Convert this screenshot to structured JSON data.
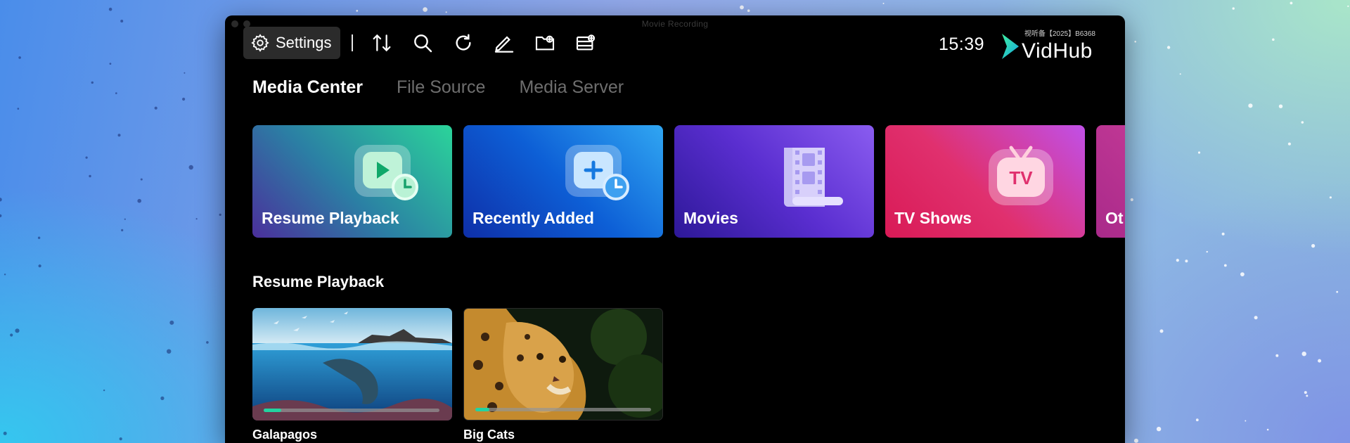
{
  "window": {
    "title": "Movie Recording"
  },
  "toolbar": {
    "settings_label": "Settings",
    "icons": [
      "sort-icon",
      "search-icon",
      "refresh-icon",
      "edit-icon",
      "add-folder-icon",
      "add-server-icon"
    ]
  },
  "header": {
    "time": "15:39",
    "logo_text": "VidHub",
    "logo_caption": "视听备【2025】B6368"
  },
  "tabs": [
    {
      "label": "Media Center",
      "active": true
    },
    {
      "label": "File Source",
      "active": false
    },
    {
      "label": "Media Server",
      "active": false
    }
  ],
  "categories": [
    {
      "label": "Resume Playback",
      "icon": "play-clock-icon",
      "colors": [
        "#16324a",
        "#2bd49a"
      ]
    },
    {
      "label": "Recently Added",
      "icon": "add-clock-icon",
      "colors": [
        "#0b4fb3",
        "#2f9ff0"
      ]
    },
    {
      "label": "Movies",
      "icon": "film-reel-icon",
      "colors": [
        "#3a1fa0",
        "#8a5cf0"
      ]
    },
    {
      "label": "TV Shows",
      "icon": "tv-icon",
      "colors": [
        "#e0306e",
        "#c050e8"
      ]
    },
    {
      "label": "Ot",
      "icon": "",
      "colors": [
        "#c3309a",
        "#e85aa8"
      ]
    }
  ],
  "resume": {
    "title": "Resume Playback",
    "items": [
      {
        "title": "Galapagos",
        "progress": 0.1
      },
      {
        "title": "Big Cats",
        "progress": 0.08
      }
    ]
  },
  "colors": {
    "accent": "#22d3a0",
    "window_bg": "#000000",
    "tab_inactive": "#6e6e6e"
  }
}
